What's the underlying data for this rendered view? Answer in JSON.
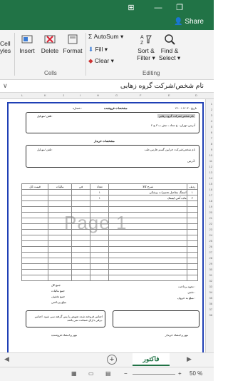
{
  "titlebar": {
    "icons": [
      "window-layout-icon",
      "minimize-icon",
      "restore-icon"
    ],
    "share_label": "Share"
  },
  "ribbon": {
    "cells_partial": "Cell",
    "styles_partial": "yles",
    "insert_label": "Insert",
    "delete_label": "Delete",
    "format_label": "Format",
    "cells_group_label": "Cells",
    "autosum_label": "AutoSum",
    "fill_label": "Fill",
    "clear_label": "Clear",
    "sort_filter_label_1": "Sort &",
    "sort_filter_label_2": "Filter",
    "find_select_label_1": "Find &",
    "find_select_label_2": "Select",
    "editing_group_label": "Editing"
  },
  "formula_bar": {
    "content": "نام شخص/شرکت گروه زهابی"
  },
  "sheet": {
    "watermark": "Page 1",
    "invoice": {
      "date_label": "تاریخ : ۱۴۰۰/۰۲/۰۳",
      "number_label": "شماره :",
      "seller_heading": "مشخصات فروشنده",
      "seller_name": "نام شخص/شرکت گروه زهابی",
      "seller_phone": "تلفن /موبایل:",
      "seller_address": "آدرس: تهران ، خ ستاد ، نبش ب ۳ ج ۲",
      "buyer_heading": "مشخصات خریدار",
      "buyer_name": "نام شخص/شرکت: فرابین گستر فارس طب",
      "buyer_phone": "تلفن /موبایل:",
      "buyer_address": "آدرس:",
      "table_headers": [
        "ردیف",
        "شرح کالا",
        "تعداد",
        "فی",
        "مالیات",
        "قیمت کل"
      ],
      "rows": [
        [
          "۱",
          "استنگ مفاصل تحمیرات پزشکی",
          "۱",
          "",
          "",
          ""
        ],
        [
          "۲",
          "ماده آنتی ایتیمک",
          "۱",
          "",
          "",
          ""
        ]
      ],
      "sum_labels": [
        "جمع کل",
        "جمع مالیات",
        "جمع تخفیف",
        "مبلغ پرداختی"
      ],
      "payment_labels": [
        "نحوه پرداخت :",
        "نقدی :",
        "مبلغ به حروف :"
      ],
      "note_text": "اجناس فروخته شده تعویض یا پس گرفته نمی شود. اجناس برقی دارای ضمانت نمی باشد.",
      "signature_seller": "مهر و امضاء فروشنده",
      "signature_buyer": "مهر و امضاء خریدار"
    },
    "tab_name": "فاکتور"
  },
  "statusbar": {
    "zoom": "50 %"
  }
}
